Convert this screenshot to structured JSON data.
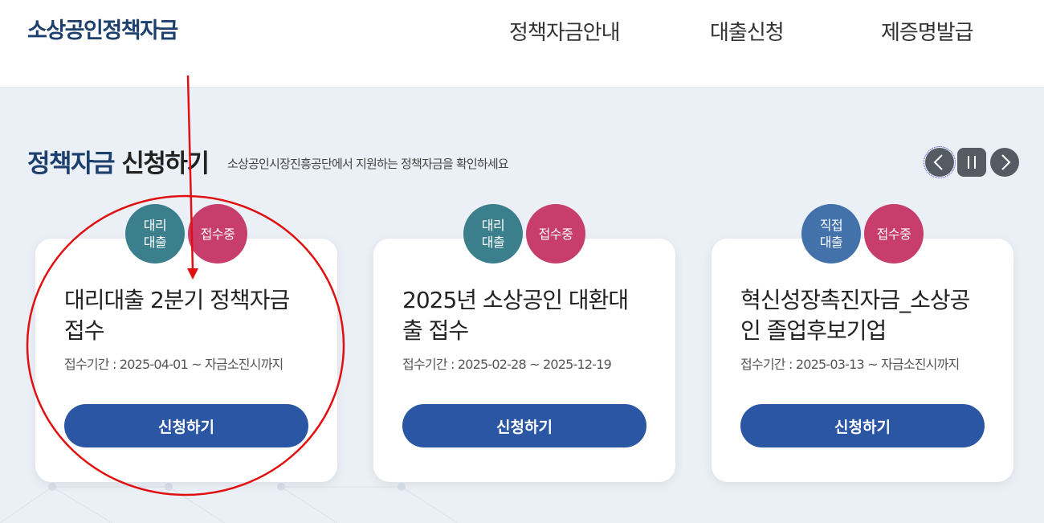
{
  "header": {
    "logo": "소상공인정책자금",
    "nav": [
      "정책자금안내",
      "대출신청",
      "제증명발급"
    ]
  },
  "section": {
    "title_highlight": "정책자금",
    "title_rest": " 신청하기",
    "subtitle": "소상공인시장진흥공단에서 지원하는 정책자금을 확인하세요"
  },
  "carousel": {
    "prev_icon": "chevron-left-icon",
    "pause_icon": "pause-icon",
    "next_icon": "chevron-right-icon"
  },
  "cards": [
    {
      "type_badge": [
        "대리",
        "대출"
      ],
      "status_badge": "접수중",
      "title": "대리대출 2분기 정책자금 접수",
      "period": "접수기간 : 2025-04-01 ~ 자금소진시까지",
      "button": "신청하기"
    },
    {
      "type_badge": [
        "대리",
        "대출"
      ],
      "status_badge": "접수중",
      "title": "2025년 소상공인 대환대출 접수",
      "period": "접수기간 : 2025-02-28 ~ 2025-12-19",
      "button": "신청하기"
    },
    {
      "type_badge": [
        "직접",
        "대출"
      ],
      "status_badge": "접수중",
      "title": "혁신성장촉진자금_소상공인 졸업후보기업",
      "period": "접수기간 : 2025-03-13 ~ 자금소진시까지",
      "button": "신청하기"
    }
  ],
  "colors": {
    "brand": "#1d3f6e",
    "button": "#2b56a4",
    "badge_agent": "#3b7e8c",
    "badge_direct": "#4272a9",
    "badge_status": "#c73d6b",
    "annotation": "#e01010"
  }
}
